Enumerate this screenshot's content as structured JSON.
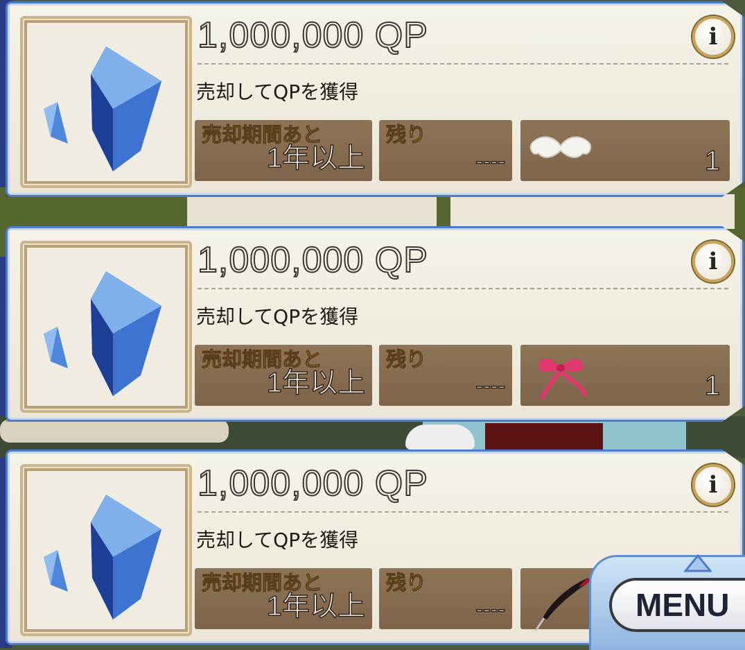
{
  "items": [
    {
      "price": "1,000,000 QP",
      "info": "i",
      "description": "売却してQPを獲得",
      "sell_period_label": "売却期間あと",
      "sell_period_value": "1年以上",
      "remaining_label": "残り",
      "remaining_value": "----",
      "extra_icon": "mustache-icon",
      "extra_count": "1"
    },
    {
      "price": "1,000,000 QP",
      "info": "i",
      "description": "売却してQPを獲得",
      "sell_period_label": "売却期間あと",
      "sell_period_value": "1年以上",
      "remaining_label": "残り",
      "remaining_value": "----",
      "extra_icon": "ribbon-icon",
      "extra_count": "1"
    },
    {
      "price": "1,000,000 QP",
      "info": "i",
      "description": "売却してQPを獲得",
      "sell_period_label": "売却期間あと",
      "sell_period_value": "1年以上",
      "remaining_label": "残り",
      "remaining_value": "----",
      "extra_icon": "quill-icon"
    }
  ],
  "menu": {
    "label": "MENU"
  },
  "colors": {
    "card_border": "#4d7bc8",
    "field_bg": "#8f7457",
    "label_gold": "#e8b24a"
  }
}
